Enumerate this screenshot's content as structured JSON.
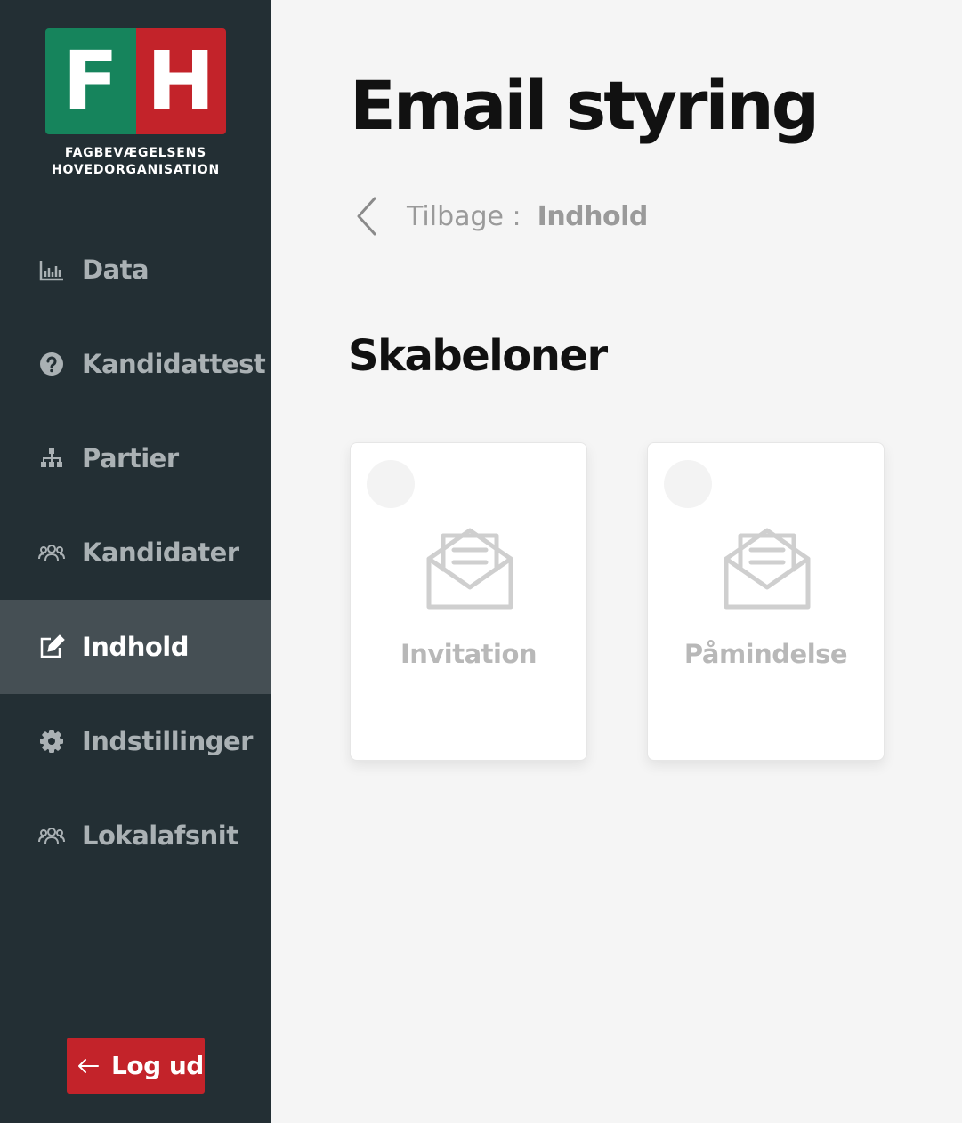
{
  "logo": {
    "left_letter": "F",
    "right_letter": "H",
    "line1": "FAGBEVÆGELSENS",
    "line2": "HOVEDORGANISATION",
    "colors": {
      "green": "#16845c",
      "red": "#c3232a"
    }
  },
  "sidebar": {
    "background": "#232f34",
    "items": [
      {
        "label": "Data",
        "icon": "bar-chart-icon",
        "active": false
      },
      {
        "label": "Kandidattest",
        "icon": "question-circle-icon",
        "active": false
      },
      {
        "label": "Partier",
        "icon": "sitemap-icon",
        "active": false
      },
      {
        "label": "Kandidater",
        "icon": "users-icon",
        "active": false
      },
      {
        "label": "Indhold",
        "icon": "edit-icon",
        "active": true
      },
      {
        "label": "Indstillinger",
        "icon": "gear-icon",
        "active": false
      },
      {
        "label": "Lokalafsnit",
        "icon": "users-icon",
        "active": false
      }
    ],
    "logout": {
      "label": "Log ud",
      "icon": "arrow-left-icon"
    }
  },
  "main": {
    "title": "Email styring",
    "breadcrumb": {
      "back_label": "Tilbage :",
      "target": "Indhold",
      "icon": "chevron-left-icon"
    },
    "section_title": "Skabeloner",
    "templates": [
      {
        "label": "Invitation",
        "icon": "envelope-open-icon"
      },
      {
        "label": "Påmindelse",
        "icon": "envelope-open-icon"
      }
    ]
  }
}
